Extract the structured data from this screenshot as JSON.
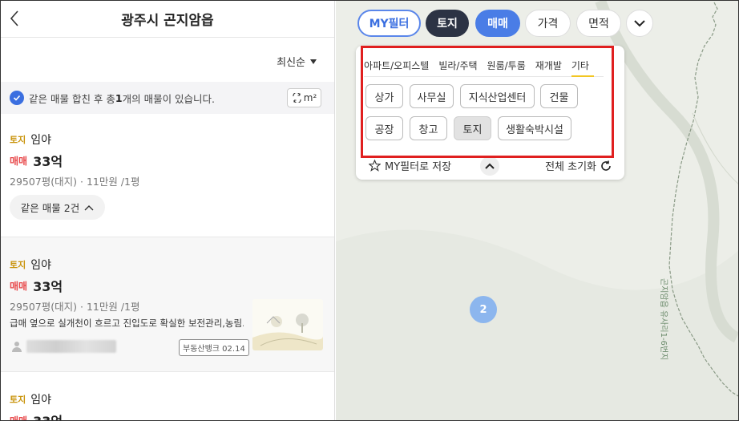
{
  "header": {
    "title": "광주시 곤지암읍"
  },
  "sort": {
    "label": "최신순"
  },
  "notice": {
    "prefix": "같은 매물 합친 후 총 ",
    "count": "1",
    "suffix": "개의 매물이 있습니다."
  },
  "unit_toggle": {
    "label": "m²"
  },
  "listings": [
    {
      "type_tag": "토지",
      "type": "임야",
      "deal_tag": "매매",
      "price": "33억",
      "detail": "29507평(대지) · 11만원 /1평",
      "same_btn": "같은 매물 2건"
    },
    {
      "type_tag": "토지",
      "type": "임야",
      "deal_tag": "매매",
      "price": "33억",
      "detail": "29507평(대지) · 11만원 /1평",
      "desc": "급매 옆으로 실개천이 흐르고 진입도로 확실한 보전관리,농림...",
      "badge": "부동산뱅크 02.14"
    },
    {
      "type_tag": "토지",
      "type": "임야",
      "deal_tag": "매매",
      "price": "33억"
    }
  ],
  "filters": {
    "my": "MY필터",
    "land": "토지",
    "sale": "매매",
    "price": "가격",
    "area": "면적"
  },
  "panel": {
    "tabs": [
      "아파트/오피스텔",
      "빌라/주택",
      "원룸/투룸",
      "재개발",
      "기타"
    ],
    "chips": [
      "상가",
      "사무실",
      "지식산업센터",
      "건물",
      "공장",
      "창고",
      "토지",
      "생활숙박시설"
    ],
    "selected_chip": "토지",
    "save_label": "MY필터로 저장",
    "reset_label": "전체 초기화"
  },
  "map": {
    "cluster_count": "2",
    "road_label": "곤지암읍 유사리1-6번지"
  },
  "colors": {
    "accent": "#4a7de6",
    "dark": "#2c3344",
    "highlight": "#e01f1f",
    "land_tag": "#c9930a",
    "sale_tag": "#e8484a"
  }
}
